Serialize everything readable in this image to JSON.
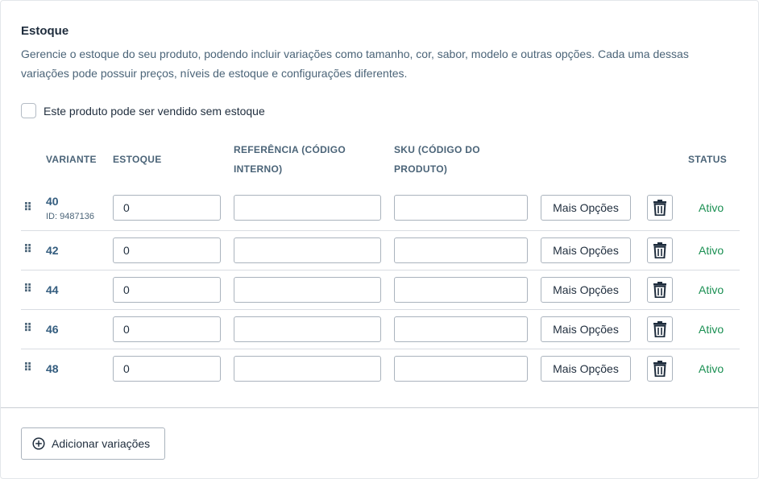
{
  "section": {
    "title": "Estoque",
    "description": "Gerencie o estoque do seu produto, podendo incluir variações como tamanho, cor, sabor, modelo e outras opções. Cada uma dessas variações pode possuir preços, níveis de estoque e configurações diferentes."
  },
  "sell_without_stock": {
    "label": "Este produto pode ser vendido sem estoque",
    "checked": false
  },
  "table": {
    "headers": {
      "variant": "VARIANTE",
      "stock": "ESTOQUE",
      "reference_line1": "REFERÊNCIA (CÓDIGO",
      "reference_line2": "INTERNO)",
      "sku_line1": "SKU (CÓDIGO DO",
      "sku_line2": "PRODUTO)",
      "status": "STATUS"
    },
    "rows": [
      {
        "variant": "40",
        "id_label": "ID: 9487136",
        "stock": "0",
        "reference": "",
        "sku": "",
        "more_label": "Mais Opções",
        "status": "Ativo"
      },
      {
        "variant": "42",
        "id_label": "",
        "stock": "0",
        "reference": "",
        "sku": "",
        "more_label": "Mais Opções",
        "status": "Ativo"
      },
      {
        "variant": "44",
        "id_label": "",
        "stock": "0",
        "reference": "",
        "sku": "",
        "more_label": "Mais Opções",
        "status": "Ativo"
      },
      {
        "variant": "46",
        "id_label": "",
        "stock": "0",
        "reference": "",
        "sku": "",
        "more_label": "Mais Opções",
        "status": "Ativo"
      },
      {
        "variant": "48",
        "id_label": "",
        "stock": "0",
        "reference": "",
        "sku": "",
        "more_label": "Mais Opções",
        "status": "Ativo"
      }
    ]
  },
  "footer": {
    "add_label": "Adicionar variações"
  },
  "icons": {
    "drag": "drag-handle-icon",
    "delete": "trash-icon",
    "add": "plus-circle-icon"
  },
  "colors": {
    "status_active": "#1a8f52",
    "variant_text": "#335c7e"
  }
}
